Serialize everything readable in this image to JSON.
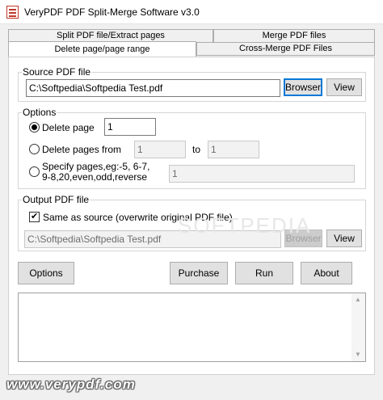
{
  "window": {
    "title": "VeryPDF PDF Split-Merge Software v3.0"
  },
  "tabs": {
    "row1": [
      "Split PDF file/Extract pages",
      "Merge PDF files"
    ],
    "row2": [
      "Delete page/page range",
      "Cross-Merge PDF Files"
    ],
    "selected": "Delete page/page range"
  },
  "source": {
    "group_label": "Source PDF file",
    "path": "C:\\Softpedia\\Softpedia Test.pdf",
    "browser_label": "Browser",
    "view_label": "View"
  },
  "options": {
    "group_label": "Options",
    "delete_page_label": "Delete page",
    "delete_page_value": "1",
    "delete_pages_from_label": "Delete pages from",
    "from_value": "1",
    "to_label": "to",
    "to_value": "1",
    "specify_label_line1": "Specify pages,eg:-5, 6-7,",
    "specify_label_line2": "9-8,20,even,odd,reverse",
    "specify_value": "1",
    "selected": "delete_page"
  },
  "output": {
    "group_label": "Output PDF file",
    "same_as_source_label": "Same as source (overwrite original PDF file)",
    "same_as_source_checked": true,
    "path": "C:\\Softpedia\\Softpedia Test.pdf",
    "browser_label": "Browser",
    "view_label": "View"
  },
  "actions": {
    "options_label": "Options",
    "purchase_label": "Purchase",
    "run_label": "Run",
    "about_label": "About"
  },
  "watermark": "SOFTPEDIA",
  "footer": {
    "url": "www.verypdf.com"
  },
  "colors": {
    "focus": "#0078d7",
    "footer_text": "#ffffff"
  }
}
